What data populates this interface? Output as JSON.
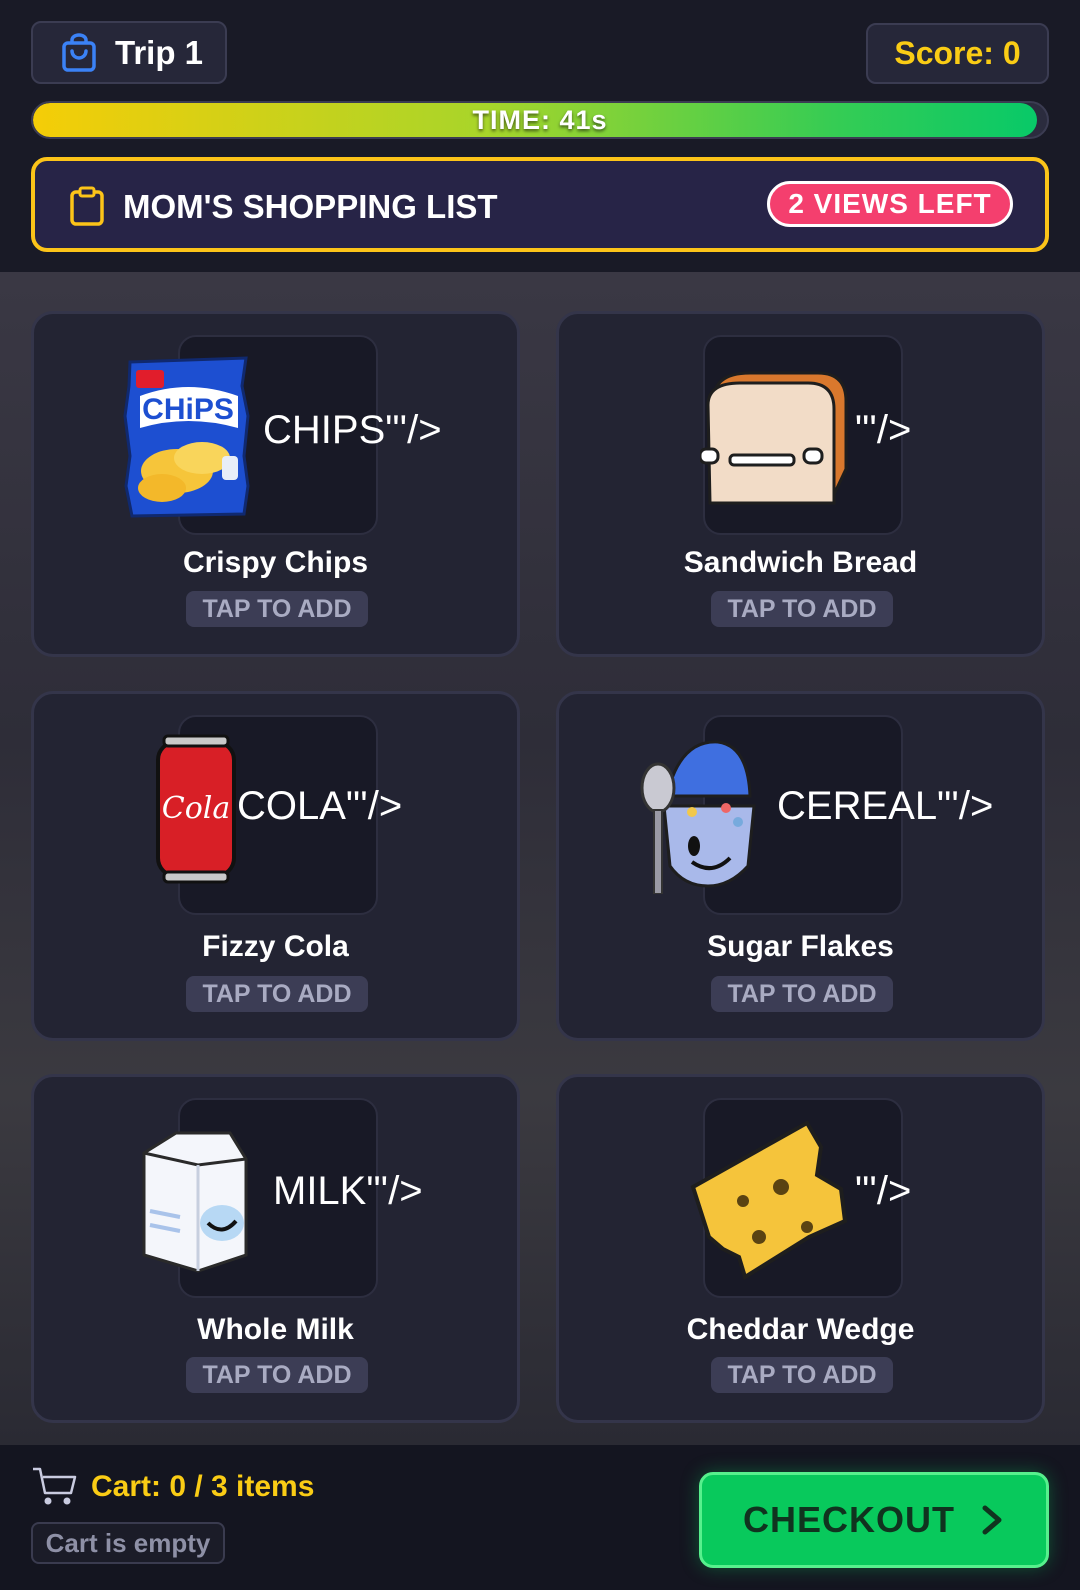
{
  "header": {
    "trip_label": "Trip 1",
    "score_label": "Score: 0",
    "timer_label": "TIME: 41s",
    "timer_fraction": 0.99
  },
  "shopping_list": {
    "title": "MOM'S SHOPPING LIST",
    "views_badge": "2 VIEWS LEFT"
  },
  "items": [
    {
      "name": "Crispy Chips",
      "image_alt": "CHIPS\"'/>",
      "image": "chips-bag-icon",
      "button": "TAP TO ADD"
    },
    {
      "name": "Sandwich Bread",
      "image_alt": "\"'/>",
      "image": "bread-loaf-icon",
      "button": "TAP TO ADD"
    },
    {
      "name": "Fizzy Cola",
      "image_alt": "COLA\"'/>",
      "image": "cola-can-icon",
      "button": "TAP TO ADD"
    },
    {
      "name": "Sugar Flakes",
      "image_alt": "CEREAL\"'/>",
      "image": "cereal-bowl-icon",
      "button": "TAP TO ADD"
    },
    {
      "name": "Whole Milk",
      "image_alt": "MILK\"'/>",
      "image": "milk-carton-icon",
      "button": "TAP TO ADD"
    },
    {
      "name": "Cheddar Wedge",
      "image_alt": "\"'/>",
      "image": "cheese-wedge-icon",
      "button": "TAP TO ADD"
    }
  ],
  "cart": {
    "count_label": "Cart: 0 / 3 items",
    "status": "Cart is empty"
  },
  "checkout": {
    "label": "CHECKOUT"
  },
  "colors": {
    "accent_yellow": "#facc15",
    "list_border": "#fcc419",
    "badge_pink": "#f43f6e",
    "checkout_green": "#08c95c"
  }
}
